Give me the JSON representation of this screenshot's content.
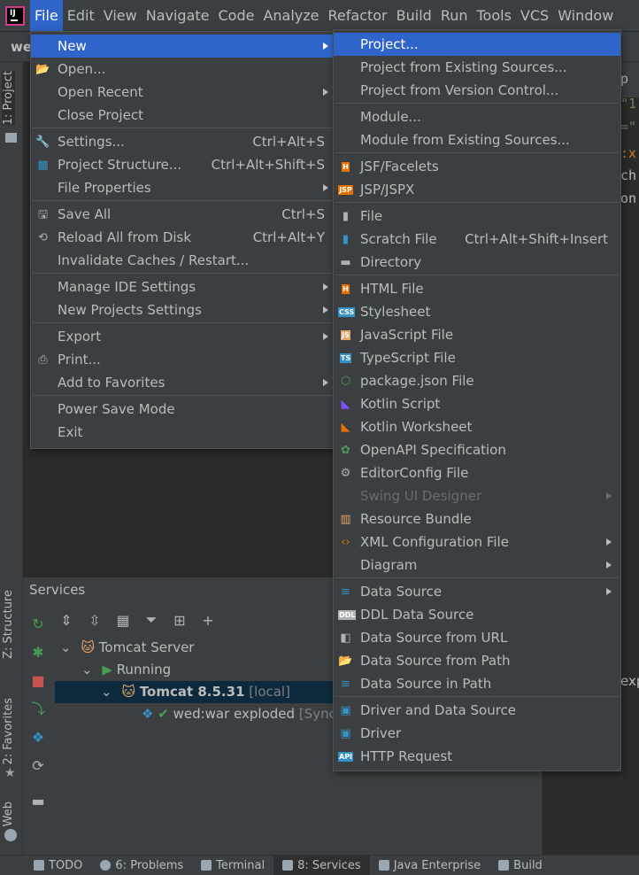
{
  "menubar": {
    "items": [
      "File",
      "Edit",
      "View",
      "Navigate",
      "Code",
      "Analyze",
      "Refactor",
      "Build",
      "Run",
      "Tools",
      "VCS",
      "Window"
    ],
    "active": "File"
  },
  "project_tag": "we",
  "side_tabs": {
    "project": "1: Project",
    "structure": "Z: Structure",
    "favorites": "2: Favorites",
    "web": "Web"
  },
  "editor_fragments": [
    "p",
    "\"1",
    "=\"",
    ":x",
    "ch",
    "on"
  ],
  "editor_bottom_fragment": "exp",
  "file_menu": {
    "items": [
      {
        "label": "New",
        "shortcut": "",
        "submenu": true,
        "icon": "",
        "highlighted": true
      },
      {
        "label": "Open...",
        "shortcut": "",
        "submenu": false,
        "icon": "folder-open-icon"
      },
      {
        "label": "Open Recent",
        "shortcut": "",
        "submenu": true,
        "icon": ""
      },
      {
        "label": "Close Project",
        "shortcut": "",
        "submenu": false,
        "icon": ""
      },
      {
        "label": "Settings...",
        "shortcut": "Ctrl+Alt+S",
        "submenu": false,
        "icon": "wrench-icon"
      },
      {
        "label": "Project Structure...",
        "shortcut": "Ctrl+Alt+Shift+S",
        "submenu": false,
        "icon": "project-structure-icon"
      },
      {
        "label": "File Properties",
        "shortcut": "",
        "submenu": true,
        "icon": ""
      },
      {
        "label": "Save All",
        "shortcut": "Ctrl+S",
        "submenu": false,
        "icon": "save-icon"
      },
      {
        "label": "Reload All from Disk",
        "shortcut": "Ctrl+Alt+Y",
        "submenu": false,
        "icon": "reload-icon"
      },
      {
        "label": "Invalidate Caches / Restart...",
        "shortcut": "",
        "submenu": false,
        "icon": ""
      },
      {
        "label": "Manage IDE Settings",
        "shortcut": "",
        "submenu": true,
        "icon": ""
      },
      {
        "label": "New Projects Settings",
        "shortcut": "",
        "submenu": true,
        "icon": ""
      },
      {
        "label": "Export",
        "shortcut": "",
        "submenu": true,
        "icon": ""
      },
      {
        "label": "Print...",
        "shortcut": "",
        "submenu": false,
        "icon": "print-icon"
      },
      {
        "label": "Add to Favorites",
        "shortcut": "",
        "submenu": true,
        "icon": ""
      },
      {
        "label": "Power Save Mode",
        "shortcut": "",
        "submenu": false,
        "icon": ""
      },
      {
        "label": "Exit",
        "shortcut": "",
        "submenu": false,
        "icon": ""
      }
    ]
  },
  "new_menu": {
    "items": [
      {
        "label": "Project...",
        "shortcut": "",
        "submenu": false,
        "icon": "",
        "highlighted": true
      },
      {
        "label": "Project from Existing Sources...",
        "shortcut": "",
        "submenu": false,
        "icon": ""
      },
      {
        "label": "Project from Version Control...",
        "shortcut": "",
        "submenu": false,
        "icon": ""
      },
      {
        "label": "Module...",
        "shortcut": "",
        "submenu": false,
        "icon": ""
      },
      {
        "label": "Module from Existing Sources...",
        "shortcut": "",
        "submenu": false,
        "icon": ""
      },
      {
        "label": "JSF/Facelets",
        "shortcut": "",
        "submenu": false,
        "icon": "jsf-icon",
        "badge": "H"
      },
      {
        "label": "JSP/JSPX",
        "shortcut": "",
        "submenu": false,
        "icon": "jsp-icon",
        "badge": "JSP"
      },
      {
        "label": "File",
        "shortcut": "",
        "submenu": false,
        "icon": "file-icon"
      },
      {
        "label": "Scratch File",
        "shortcut": "Ctrl+Alt+Shift+Insert",
        "submenu": false,
        "icon": "scratch-file-icon"
      },
      {
        "label": "Directory",
        "shortcut": "",
        "submenu": false,
        "icon": "directory-icon"
      },
      {
        "label": "HTML File",
        "shortcut": "",
        "submenu": false,
        "icon": "html-file-icon",
        "badge": "H"
      },
      {
        "label": "Stylesheet",
        "shortcut": "",
        "submenu": false,
        "icon": "css-file-icon",
        "badge": "CSS"
      },
      {
        "label": "JavaScript File",
        "shortcut": "",
        "submenu": false,
        "icon": "js-file-icon",
        "badge": "JS"
      },
      {
        "label": "TypeScript File",
        "shortcut": "",
        "submenu": false,
        "icon": "ts-file-icon",
        "badge": "TS"
      },
      {
        "label": "package.json File",
        "shortcut": "",
        "submenu": false,
        "icon": "nodejs-icon"
      },
      {
        "label": "Kotlin Script",
        "shortcut": "",
        "submenu": false,
        "icon": "kotlin-icon"
      },
      {
        "label": "Kotlin Worksheet",
        "shortcut": "",
        "submenu": false,
        "icon": "kotlin-worksheet-icon"
      },
      {
        "label": "OpenAPI Specification",
        "shortcut": "",
        "submenu": false,
        "icon": "openapi-icon"
      },
      {
        "label": "EditorConfig File",
        "shortcut": "",
        "submenu": false,
        "icon": "gear-icon"
      },
      {
        "label": "Swing UI Designer",
        "shortcut": "",
        "submenu": true,
        "icon": "",
        "disabled": true
      },
      {
        "label": "Resource Bundle",
        "shortcut": "",
        "submenu": false,
        "icon": "resource-bundle-icon"
      },
      {
        "label": "XML Configuration File",
        "shortcut": "",
        "submenu": true,
        "icon": "xml-icon"
      },
      {
        "label": "Diagram",
        "shortcut": "",
        "submenu": true,
        "icon": ""
      },
      {
        "label": "Data Source",
        "shortcut": "",
        "submenu": true,
        "icon": "database-icon"
      },
      {
        "label": "DDL Data Source",
        "shortcut": "",
        "submenu": false,
        "icon": "ddl-icon",
        "badge": "DDL"
      },
      {
        "label": "Data Source from URL",
        "shortcut": "",
        "submenu": false,
        "icon": "url-source-icon"
      },
      {
        "label": "Data Source from Path",
        "shortcut": "",
        "submenu": false,
        "icon": "folder-open-icon"
      },
      {
        "label": "Data Source in Path",
        "shortcut": "",
        "submenu": false,
        "icon": "database-icon"
      },
      {
        "label": "Driver and Data Source",
        "shortcut": "",
        "submenu": false,
        "icon": "driver-icon"
      },
      {
        "label": "Driver",
        "shortcut": "",
        "submenu": false,
        "icon": "driver-icon"
      },
      {
        "label": "HTTP Request",
        "shortcut": "",
        "submenu": false,
        "icon": "api-icon",
        "badge": "API"
      }
    ]
  },
  "services": {
    "title": "Services",
    "tree": [
      {
        "label": "Tomcat Server",
        "suffix": ""
      },
      {
        "label": "Running",
        "suffix": ""
      },
      {
        "label": "Tomcat 8.5.31",
        "suffix": "[local]"
      },
      {
        "label": "wed:war exploded",
        "suffix": "[Sync"
      }
    ]
  },
  "statusbar": {
    "tabs": [
      "TODO",
      "6: Problems",
      "Terminal",
      "8: Services",
      "Java Enterprise",
      "Build"
    ],
    "active": "8: Services"
  },
  "colors": {
    "highlight": "#2f65ca",
    "menu_bg": "#3c3f41",
    "editor_bg": "#2b2b2b",
    "selection_bg": "#0d293e",
    "running_green": "#499c54",
    "stop_red": "#c75450"
  }
}
